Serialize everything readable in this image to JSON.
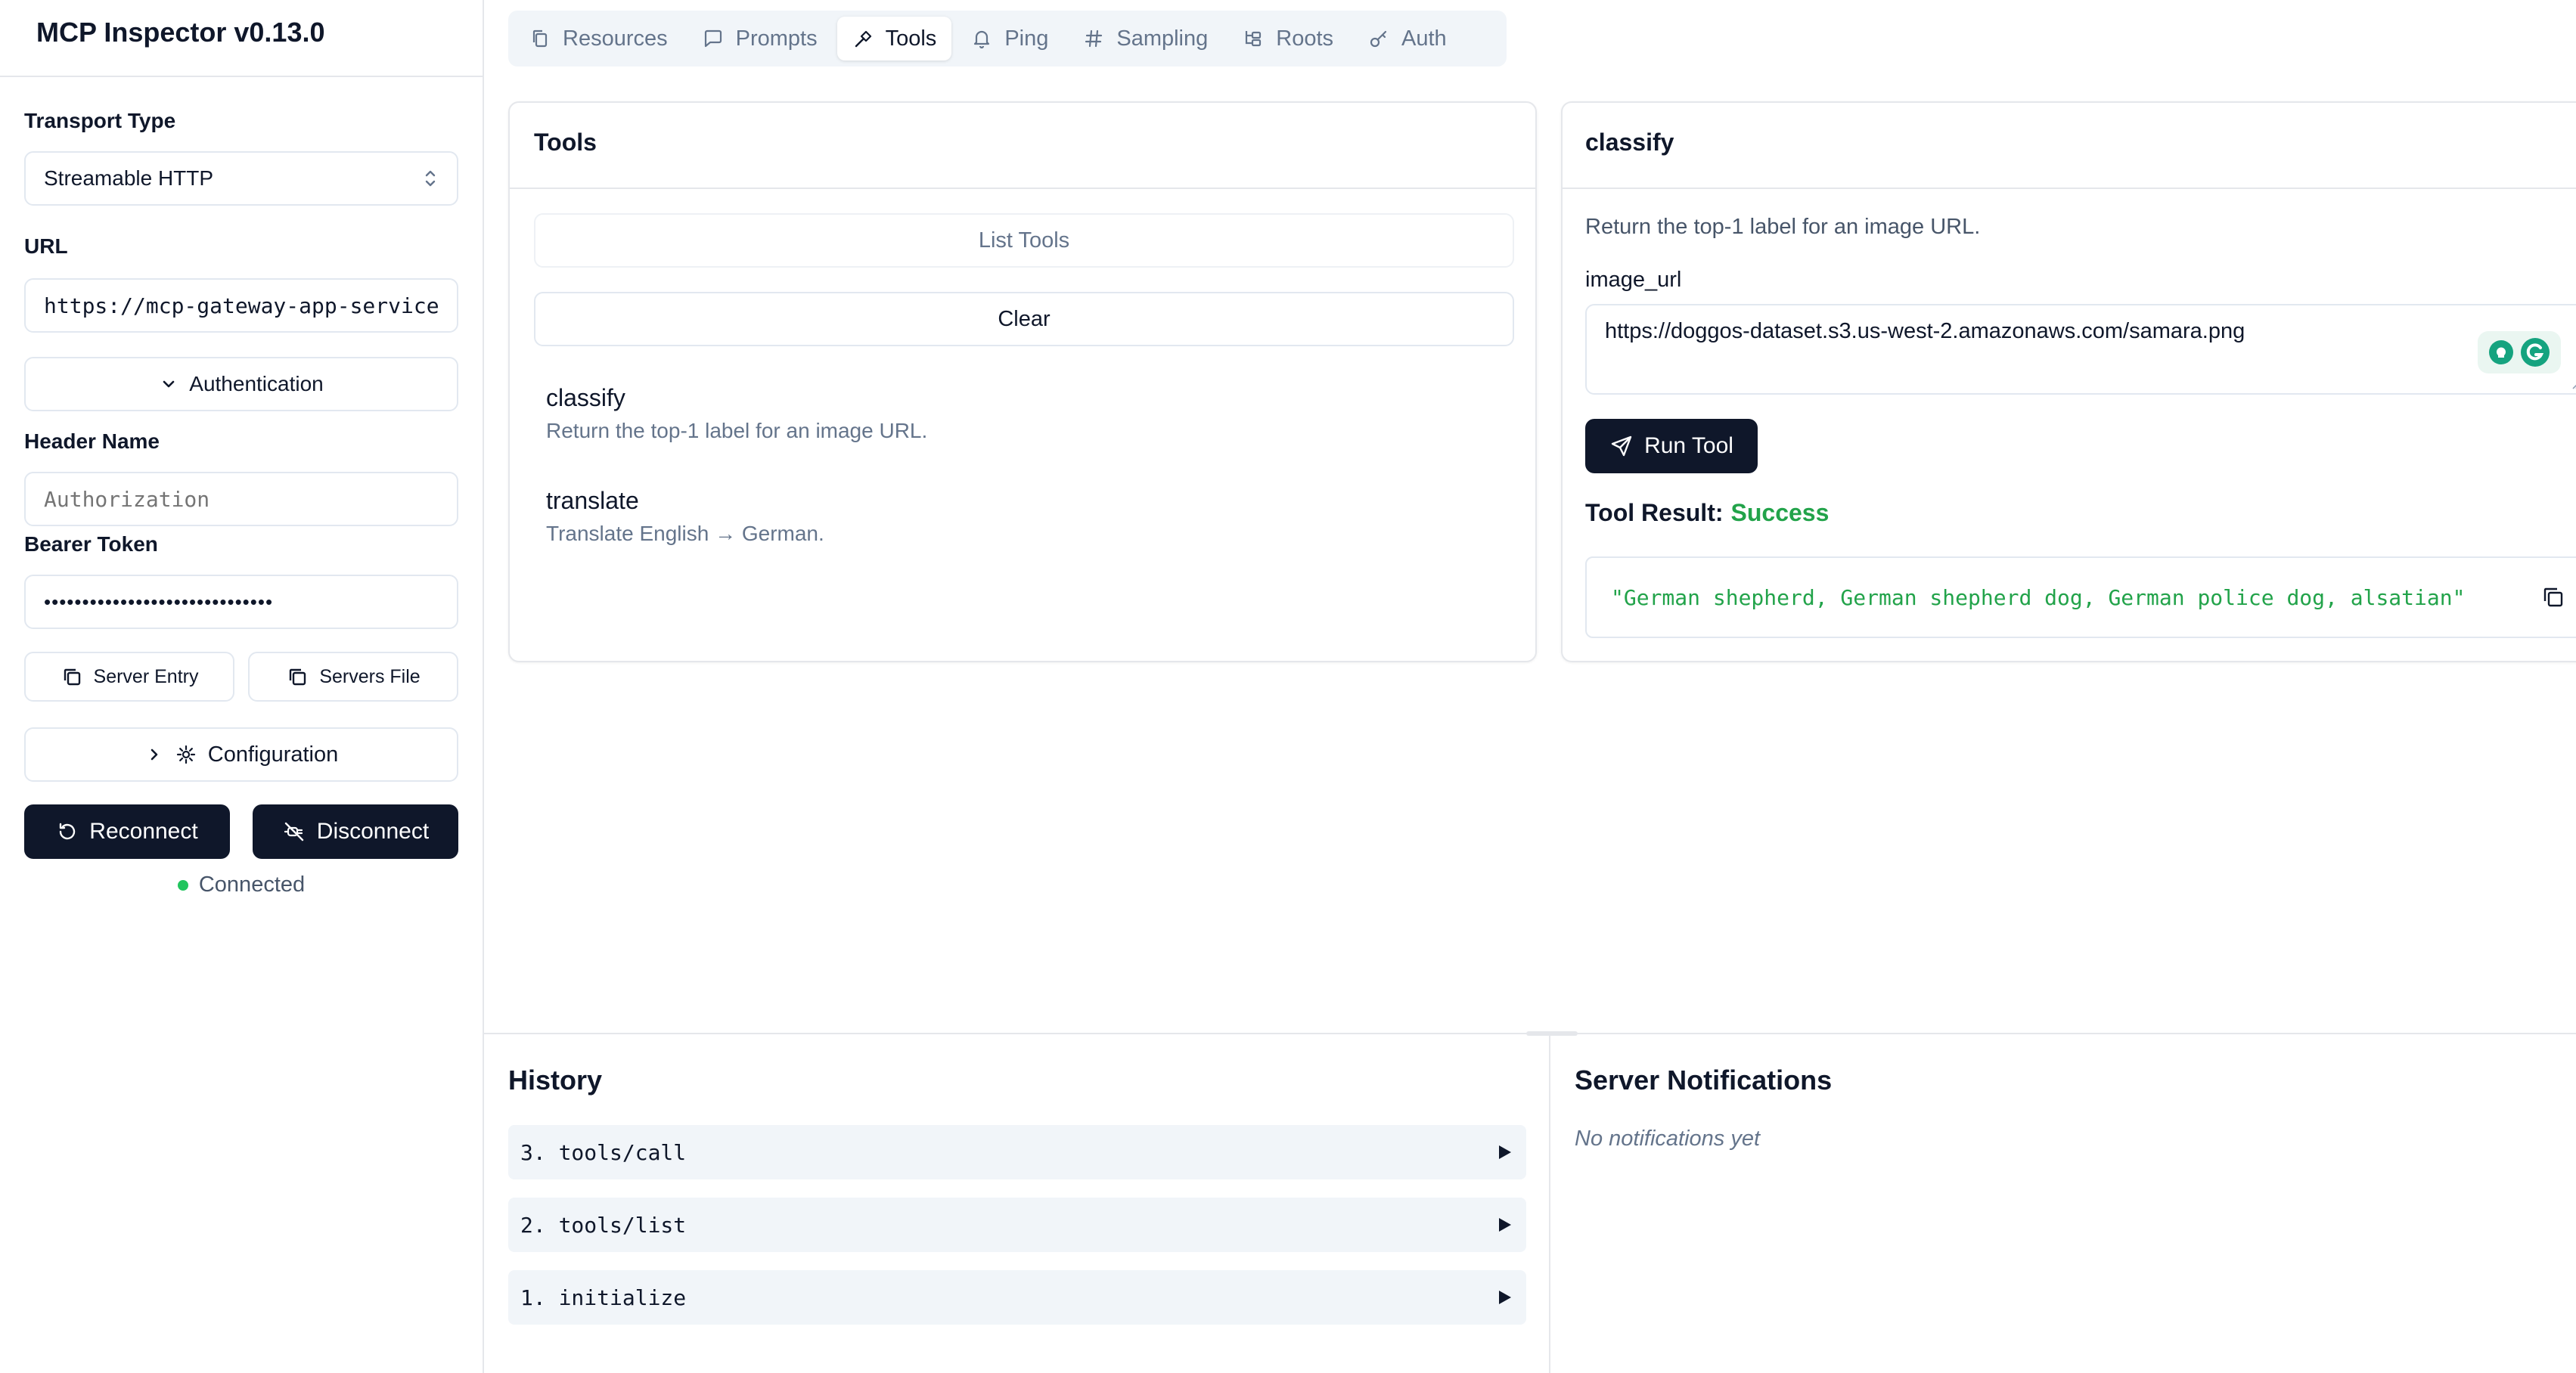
{
  "app": {
    "title": "MCP Inspector v0.13.0"
  },
  "sidebar": {
    "transport_type_label": "Transport Type",
    "transport_type_value": "Streamable HTTP",
    "url_label": "URL",
    "url_value": "https://mcp-gateway-app-service",
    "authentication_label": "Authentication",
    "header_name_label": "Header Name",
    "header_name_placeholder": "Authorization",
    "bearer_token_label": "Bearer Token",
    "bearer_token_value": "••••••••••••••••••••••••••••••",
    "server_entry_label": "Server Entry",
    "servers_file_label": "Servers File",
    "configuration_label": "Configuration",
    "reconnect_label": "Reconnect",
    "disconnect_label": "Disconnect",
    "status_text": "Connected",
    "status_color": "#22c55e"
  },
  "tabs": [
    {
      "label": "Resources",
      "icon": "files-icon"
    },
    {
      "label": "Prompts",
      "icon": "message-square-icon"
    },
    {
      "label": "Tools",
      "icon": "hammer-icon",
      "active": true
    },
    {
      "label": "Ping",
      "icon": "bell-icon"
    },
    {
      "label": "Sampling",
      "icon": "hash-icon"
    },
    {
      "label": "Roots",
      "icon": "folder-tree-icon"
    },
    {
      "label": "Auth",
      "icon": "key-icon"
    }
  ],
  "tools_panel": {
    "title": "Tools",
    "list_tools_label": "List Tools",
    "clear_label": "Clear",
    "items": [
      {
        "name": "classify",
        "description": "Return the top-1 label for an image URL."
      },
      {
        "name": "translate",
        "description": "Translate English → German."
      }
    ]
  },
  "tool_detail": {
    "title": "classify",
    "description": "Return the top-1 label for an image URL.",
    "param_label": "image_url",
    "param_value": "https://doggos-dataset.s3.us-west-2.amazonaws.com/samara.png",
    "run_label": "Run Tool",
    "result_label": "Tool Result:",
    "result_status": "Success",
    "result_status_color": "#22a34a",
    "result_value": "\"German shepherd, German shepherd dog, German police dog, alsatian\"",
    "result_value_color": "#22a34a"
  },
  "history": {
    "title": "History",
    "items": [
      {
        "label": "3. tools/call"
      },
      {
        "label": "2. tools/list"
      },
      {
        "label": "1. initialize"
      }
    ]
  },
  "notifications": {
    "title": "Server Notifications",
    "empty_text": "No notifications yet"
  }
}
